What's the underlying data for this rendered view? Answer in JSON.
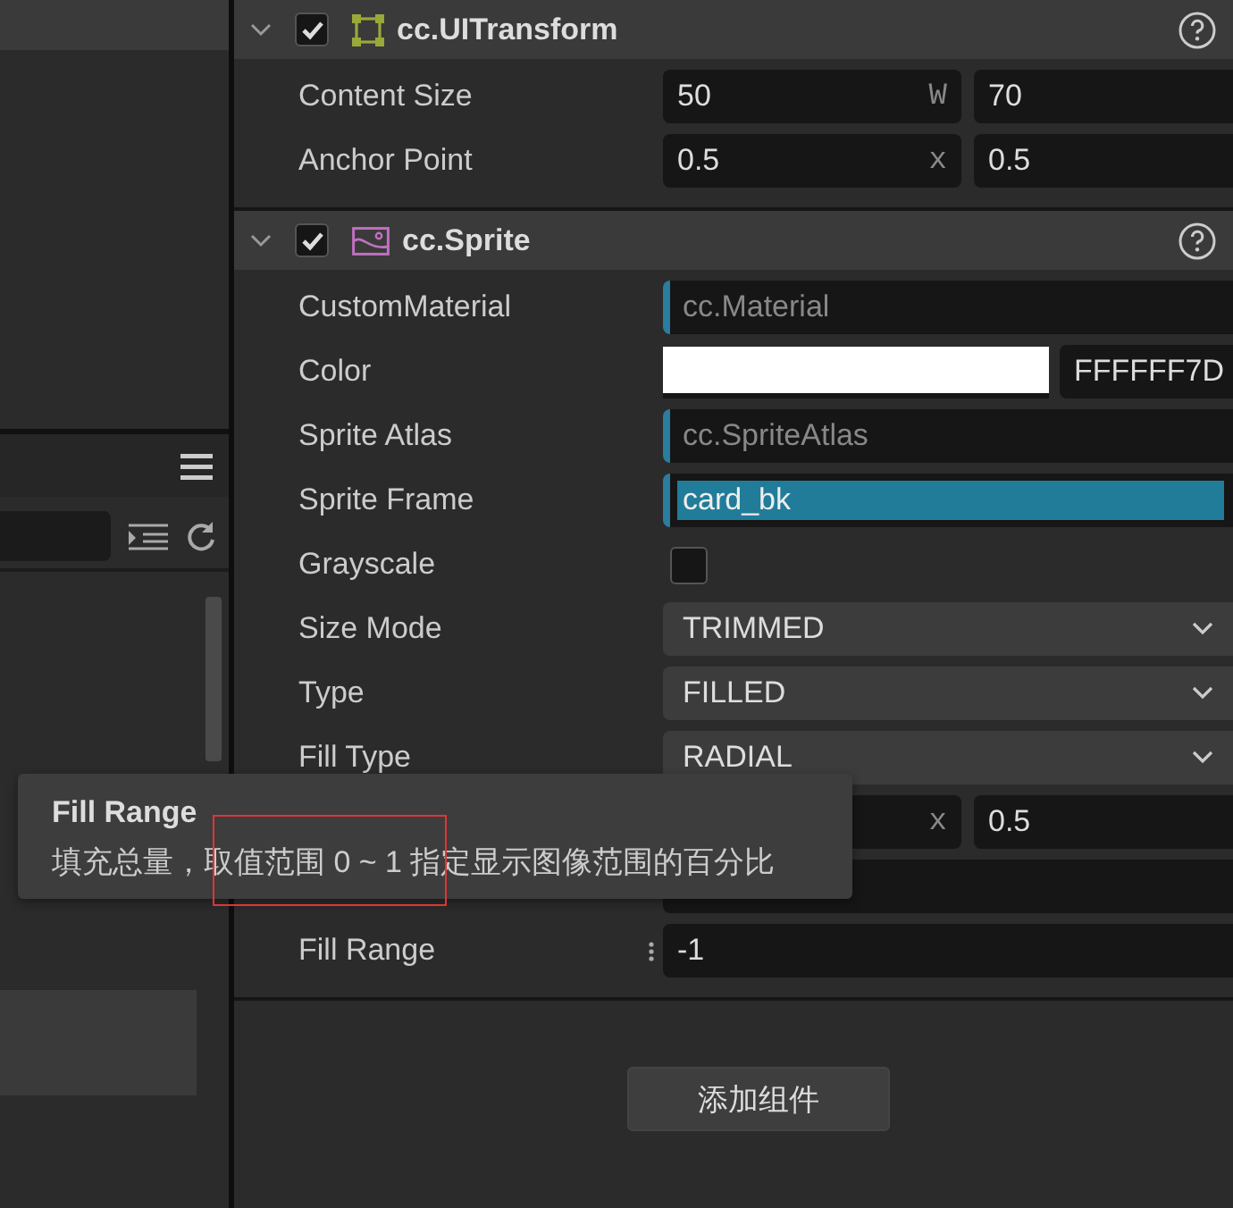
{
  "components": [
    {
      "title": "cc.UITransform",
      "enabled": true,
      "kind": "transform",
      "properties": [
        {
          "kind": "vec2",
          "label": "Content Size",
          "values": [
            {
              "value": "50",
              "axis": "W"
            },
            {
              "value": "70"
            }
          ]
        },
        {
          "kind": "vec2",
          "label": "Anchor Point",
          "values": [
            {
              "value": "0.5",
              "axis": "x"
            },
            {
              "value": "0.5"
            }
          ]
        }
      ]
    },
    {
      "title": "cc.Sprite",
      "enabled": true,
      "kind": "sprite",
      "properties": [
        {
          "kind": "asset",
          "label": "CustomMaterial",
          "value": "cc.Material",
          "highlighted": false
        },
        {
          "kind": "color",
          "label": "Color",
          "value": "FFFFFF7D"
        },
        {
          "kind": "asset",
          "label": "Sprite Atlas",
          "value": "cc.SpriteAtlas",
          "highlighted": false
        },
        {
          "kind": "asset",
          "label": "Sprite Frame",
          "value": "card_bk",
          "highlighted": true
        },
        {
          "kind": "checkbox",
          "label": "Grayscale",
          "checked": false
        },
        {
          "kind": "select",
          "label": "Size Mode",
          "value": "TRIMMED"
        },
        {
          "kind": "select",
          "label": "Type",
          "value": "FILLED"
        },
        {
          "kind": "select",
          "label": "Fill Type",
          "value": "RADIAL"
        },
        {
          "kind": "vec2",
          "values": [
            {
              "axis": "x"
            },
            {
              "value": "0.5"
            }
          ]
        },
        {
          "kind": "number"
        },
        {
          "kind": "number",
          "label": "Fill Range",
          "value": "-1",
          "drag_handle": true
        }
      ]
    }
  ],
  "add_button": "添加组件",
  "tooltip": {
    "title": "Fill Range",
    "text": "填充总量，取值范围 0 ~ 1 指定显示图像范围的百分比"
  }
}
